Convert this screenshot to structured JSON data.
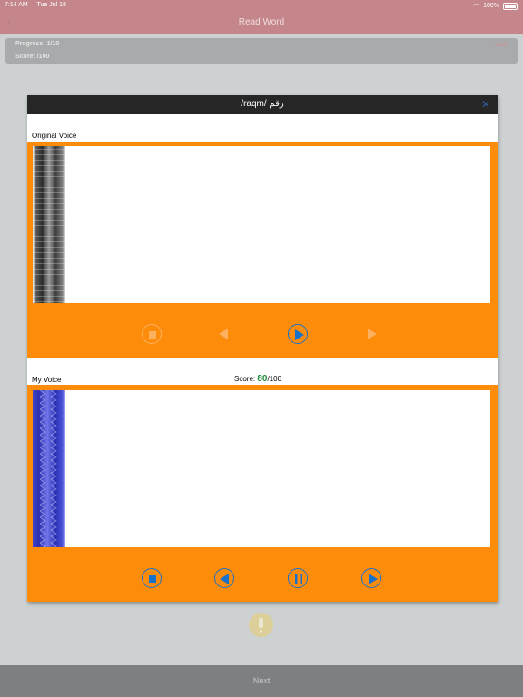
{
  "status": {
    "time": "7:14 AM",
    "date": "Tue Jul 18",
    "battery": "100%"
  },
  "nav": {
    "title": "Read Word",
    "back_glyph": "‹"
  },
  "info": {
    "progress_label": "Progress: 1/10",
    "score_label": "Score:  /100",
    "right_text": "ﮐﻠﻤﺔ"
  },
  "modal": {
    "title": "/raqm/ رقم",
    "close_glyph": "✕",
    "original": {
      "label": "Original Voice"
    },
    "mine": {
      "label": "My Voice",
      "score_prefix": "Score: ",
      "score_value": "80",
      "score_suffix": "/100"
    }
  },
  "next": {
    "label": "Next"
  },
  "colors": {
    "accent_orange": "#fd8c0b",
    "control_blue": "#1a72c8",
    "score_green": "#1f8a3b",
    "nav_bar": "#c4858b"
  }
}
